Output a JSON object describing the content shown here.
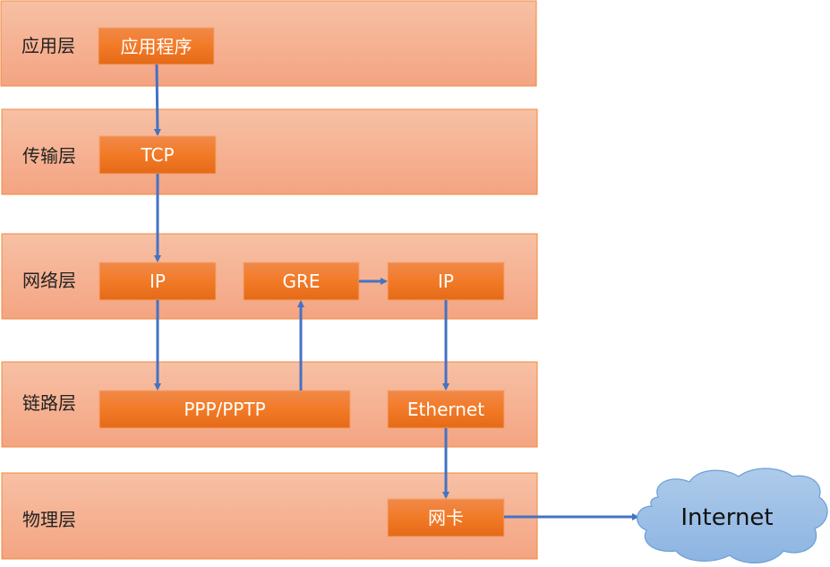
{
  "colors": {
    "layer_fill": "#f6b597",
    "layer_border": "#f08a3c",
    "box_fill": "#ee7a2a",
    "box_border": "#f4a36a",
    "arrow": "#4472c4",
    "cloud_fill": "#9dc1e6",
    "cloud_border": "#6a9fd6"
  },
  "layers": [
    {
      "label": "应用层"
    },
    {
      "label": "传输层"
    },
    {
      "label": "网络层"
    },
    {
      "label": "链路层"
    },
    {
      "label": "物理层"
    }
  ],
  "boxes": [
    {
      "label": "应用程序"
    },
    {
      "label": "TCP"
    },
    {
      "label": "IP"
    },
    {
      "label": "GRE"
    },
    {
      "label": "IP"
    },
    {
      "label": "PPP/PPTP"
    },
    {
      "label": "Ethernet"
    },
    {
      "label": "网卡"
    }
  ],
  "cloud": {
    "label": "Internet"
  }
}
